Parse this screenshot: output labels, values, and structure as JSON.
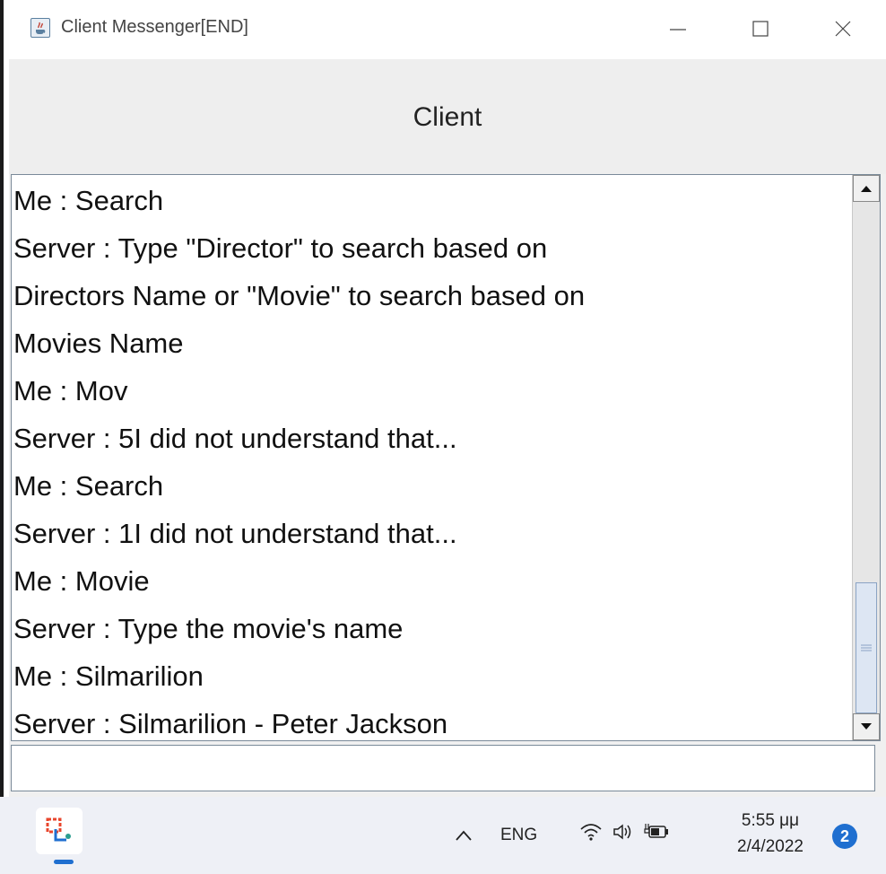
{
  "window": {
    "title": "Client Messenger[END]",
    "icon": "java-cup-icon"
  },
  "header": {
    "title": "Client"
  },
  "chat": {
    "lines": [
      "Me : Search",
      "Server : Type \"Director\" to search based on",
      "Directors Name or \"Movie\" to search based on",
      "Movies Name",
      "Me : Mov",
      "Server : 5I did not understand that...",
      "Me : Search",
      "Server : 1I did not understand that...",
      "Me : Movie",
      "Server : Type the movie's name",
      "Me : Silmarilion",
      "Server : Silmarilion - Peter Jackson"
    ]
  },
  "input": {
    "value": "",
    "placeholder": ""
  },
  "taskbar": {
    "pinned_app_icon": "snipping-tool-icon",
    "language": "ENG",
    "time": "5:55 μμ",
    "date": "2/4/2022",
    "notification_count": "2",
    "accent_color": "#1f6fd0"
  }
}
